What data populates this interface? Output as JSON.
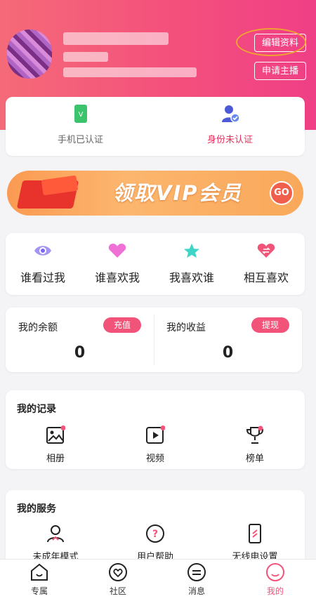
{
  "profile": {
    "edit_label": "编辑资料",
    "apply_host_label": "申请主播"
  },
  "verification": {
    "phone": {
      "label": "手机已认证",
      "color": "#666666"
    },
    "identity": {
      "label": "身份未认证",
      "color": "#e8305e"
    }
  },
  "vip_banner": {
    "text": "领取VIP会员",
    "go_label": "GO"
  },
  "social": [
    {
      "label": "谁看过我",
      "icon": "eye-icon",
      "color": "#9b8cf0"
    },
    {
      "label": "谁喜欢我",
      "icon": "heart-icon",
      "color": "#f06bd2"
    },
    {
      "label": "我喜欢谁",
      "icon": "star-icon",
      "color": "#3dd6c6"
    },
    {
      "label": "相互喜欢",
      "icon": "mutual-heart-icon",
      "color": "#f25479"
    }
  ],
  "wallet": {
    "balance": {
      "label": "我的余额",
      "button": "充值",
      "value": "0"
    },
    "earnings": {
      "label": "我的收益",
      "button": "提现",
      "value": "0"
    }
  },
  "records": {
    "title": "我的记录",
    "items": [
      {
        "label": "相册",
        "icon": "photo-album-icon"
      },
      {
        "label": "视频",
        "icon": "video-icon"
      },
      {
        "label": "榜单",
        "icon": "trophy-icon"
      }
    ]
  },
  "services": {
    "title": "我的服务",
    "items": [
      {
        "label": "未成年模式",
        "icon": "user-shield-icon"
      },
      {
        "label": "用户帮助",
        "icon": "help-icon"
      },
      {
        "label": "无线电设置",
        "icon": "phone-settings-icon"
      }
    ]
  },
  "tabbar": [
    {
      "label": "专属",
      "icon": "home-icon"
    },
    {
      "label": "社区",
      "icon": "community-icon"
    },
    {
      "label": "消息",
      "icon": "message-icon"
    },
    {
      "label": "我的",
      "icon": "profile-icon",
      "active": true
    }
  ],
  "colors": {
    "header_start": "#f56a78",
    "header_end": "#ef3f86",
    "accent": "#f25479"
  }
}
